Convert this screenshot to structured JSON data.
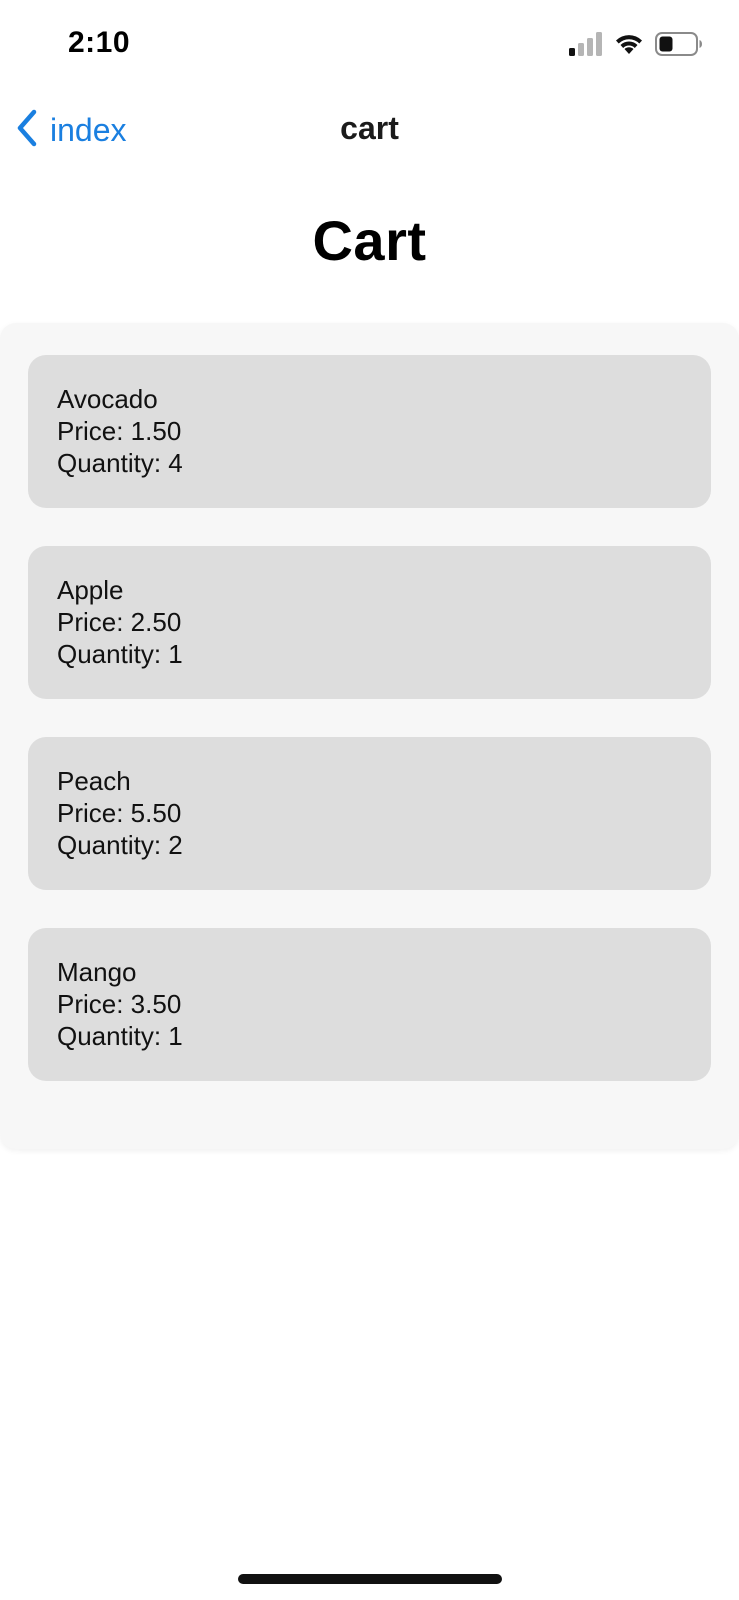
{
  "status_bar": {
    "time": "2:10",
    "signal_icon": "cellular-signal-icon",
    "wifi_icon": "wifi-icon",
    "battery_icon": "battery-icon"
  },
  "nav": {
    "back_icon": "chevron-left-icon",
    "back_label": "index",
    "title": "cart",
    "accent_color": "#1a7fe0"
  },
  "page": {
    "heading": "Cart"
  },
  "cart": {
    "items": [
      {
        "name": "Avocado",
        "price_text": "Price: 1.50",
        "quantity_text": "Quantity: 4"
      },
      {
        "name": "Apple",
        "price_text": "Price: 2.50",
        "quantity_text": "Quantity: 1"
      },
      {
        "name": "Peach",
        "price_text": "Price: 5.50",
        "quantity_text": "Quantity: 2"
      },
      {
        "name": "Mango",
        "price_text": "Price: 3.50",
        "quantity_text": "Quantity: 1"
      }
    ]
  },
  "colors": {
    "panel_bg": "#f7f7f7",
    "item_bg": "#dddddd"
  }
}
